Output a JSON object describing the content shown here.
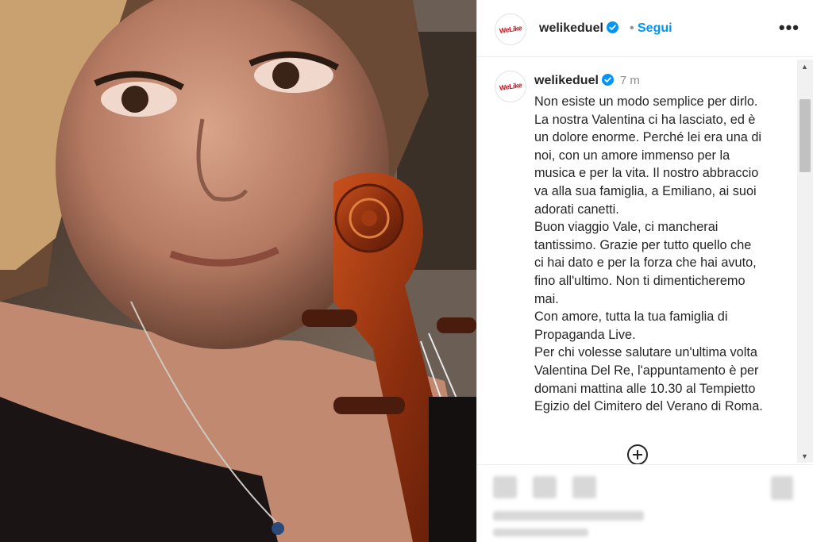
{
  "post": {
    "username": "welikeduel",
    "follow_label": "Segui",
    "separator": "•",
    "more_label": "•••",
    "avatar_logo_text": "WeLike"
  },
  "caption": {
    "username": "welikeduel",
    "time": "7 m",
    "text": "Non esiste un modo semplice per dirlo.\nLa nostra Valentina ci ha lasciato, ed è\nun dolore enorme. Perché lei era una di\nnoi, con un amore immenso per la\nmusica e per la vita. Il nostro abbraccio\nva alla sua famiglia, a Emiliano, ai suoi\nadorati canetti.\nBuon viaggio Vale, ci mancherai\ntantissimo. Grazie per tutto quello che\nci hai dato e per la forza che hai avuto,\nfino all'ultimo. Non ti dimenticheremo\nmai.\nCon amore, tutta la tua famiglia di\nPropaganda Live.\nPer chi volesse salutare un'ultima volta\nValentina Del Re, l'appuntamento è per\ndomani mattina alle 10.30 al Tempietto\nEgizio del Cimitero del Verano di Roma."
  },
  "icons": {
    "verified": "verified-badge-icon",
    "load_more": "plus-circle-icon",
    "more": "more-options-icon"
  },
  "colors": {
    "accent": "#0095f6",
    "text": "#262626",
    "muted": "#8e8e8e"
  }
}
